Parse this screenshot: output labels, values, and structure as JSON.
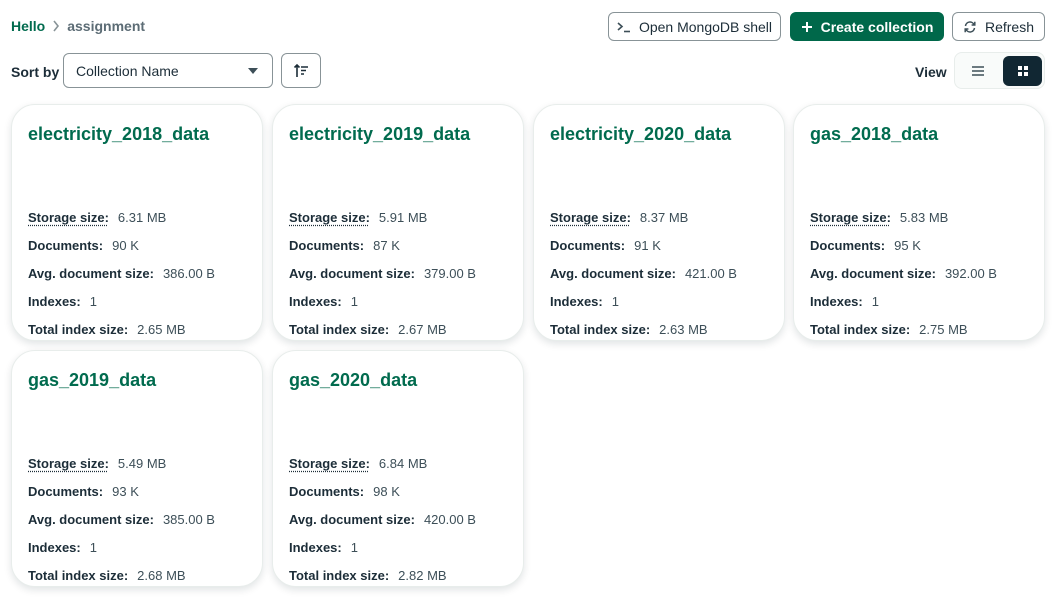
{
  "breadcrumb": {
    "root": "Hello",
    "current": "assignment"
  },
  "toolbar": {
    "shell_label": "Open MongoDB shell",
    "create_label": "Create collection",
    "refresh_label": "Refresh"
  },
  "sort": {
    "label": "Sort by",
    "selected": "Collection Name"
  },
  "view": {
    "label": "View",
    "mode": "grid"
  },
  "stat_labels": {
    "storage": "Storage size:",
    "documents": "Documents:",
    "avg": "Avg. document size:",
    "indexes": "Indexes:",
    "index_size": "Total index size:"
  },
  "collections": [
    {
      "name": "electricity_2018_data",
      "storage": "6.31 MB",
      "documents": "90 K",
      "avg": "386.00 B",
      "indexes": "1",
      "index_size": "2.65 MB"
    },
    {
      "name": "electricity_2019_data",
      "storage": "5.91 MB",
      "documents": "87 K",
      "avg": "379.00 B",
      "indexes": "1",
      "index_size": "2.67 MB"
    },
    {
      "name": "electricity_2020_data",
      "storage": "8.37 MB",
      "documents": "91 K",
      "avg": "421.00 B",
      "indexes": "1",
      "index_size": "2.63 MB"
    },
    {
      "name": "gas_2018_data",
      "storage": "5.83 MB",
      "documents": "95 K",
      "avg": "392.00 B",
      "indexes": "1",
      "index_size": "2.75 MB"
    },
    {
      "name": "gas_2019_data",
      "storage": "5.49 MB",
      "documents": "93 K",
      "avg": "385.00 B",
      "indexes": "1",
      "index_size": "2.68 MB"
    },
    {
      "name": "gas_2020_data",
      "storage": "6.84 MB",
      "documents": "98 K",
      "avg": "420.00 B",
      "indexes": "1",
      "index_size": "2.82 MB"
    }
  ],
  "colors": {
    "brand_green": "#00684a",
    "title_green": "#016b4e",
    "dark": "#112733"
  },
  "icons": [
    "chevron-right-icon",
    "shell-icon",
    "plus-icon",
    "refresh-icon",
    "caret-down-icon",
    "sort-direction-icon",
    "list-view-icon",
    "grid-view-icon"
  ]
}
